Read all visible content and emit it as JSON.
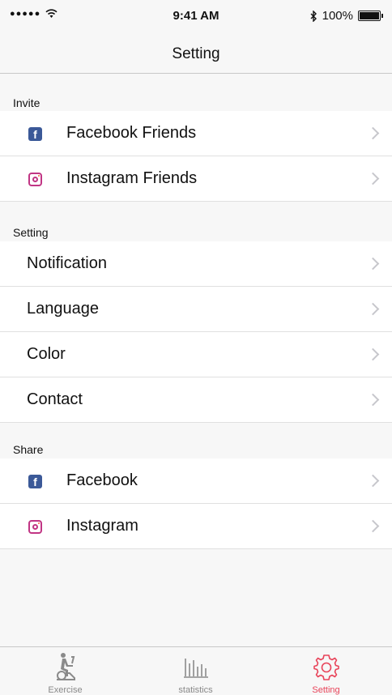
{
  "status_bar": {
    "signal": "●●●●●",
    "time": "9:41 AM",
    "battery": "100%"
  },
  "nav": {
    "title": "Setting"
  },
  "sections": [
    {
      "header": "Invite",
      "items": [
        {
          "label": "Facebook Friends",
          "icon": "facebook-icon"
        },
        {
          "label": "Instagram Friends",
          "icon": "instagram-icon"
        }
      ]
    },
    {
      "header": "Setting",
      "items": [
        {
          "label": "Notification"
        },
        {
          "label": "Language"
        },
        {
          "label": "Color"
        },
        {
          "label": "Contact"
        }
      ]
    },
    {
      "header": "Share",
      "items": [
        {
          "label": "Facebook",
          "icon": "facebook-icon"
        },
        {
          "label": "Instagram",
          "icon": "instagram-icon"
        }
      ]
    }
  ],
  "tabs": [
    {
      "label": "Exercise",
      "icon": "exercise-bike-icon",
      "active": false
    },
    {
      "label": "statistics",
      "icon": "bar-chart-icon",
      "active": false
    },
    {
      "label": "Setting",
      "icon": "gear-icon",
      "active": true
    }
  ],
  "colors": {
    "accent": "#e8445a",
    "facebook": "#3b5998",
    "instagram": "#c13584",
    "inactive": "#888888"
  }
}
